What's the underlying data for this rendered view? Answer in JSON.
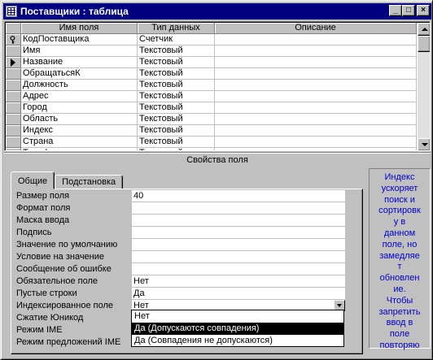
{
  "window": {
    "title": "Поставщики : таблица",
    "controls": [
      "_",
      "□",
      "×"
    ]
  },
  "grid": {
    "columns": [
      "Имя поля",
      "Тип данных",
      "Описание"
    ],
    "rows": [
      {
        "name": "КодПоставщика",
        "type": "Счетчик",
        "desc": "",
        "marker": "key"
      },
      {
        "name": "Имя",
        "type": "Текстовый",
        "desc": "",
        "marker": ""
      },
      {
        "name": "Название",
        "type": "Текстовый",
        "desc": "",
        "marker": "current"
      },
      {
        "name": "ОбращатьсяК",
        "type": "Текстовый",
        "desc": "",
        "marker": ""
      },
      {
        "name": "Должность",
        "type": "Текстовый",
        "desc": "",
        "marker": ""
      },
      {
        "name": "Адрес",
        "type": "Текстовый",
        "desc": "",
        "marker": ""
      },
      {
        "name": "Город",
        "type": "Текстовый",
        "desc": "",
        "marker": ""
      },
      {
        "name": "Область",
        "type": "Текстовый",
        "desc": "",
        "marker": ""
      },
      {
        "name": "Индекс",
        "type": "Текстовый",
        "desc": "",
        "marker": ""
      },
      {
        "name": "Страна",
        "type": "Текстовый",
        "desc": "",
        "marker": ""
      },
      {
        "name": "Телефон",
        "type": "Текстовый",
        "desc": "",
        "marker": ""
      }
    ]
  },
  "properties": {
    "header": "Свойства поля",
    "tabs": [
      {
        "label": "Общие",
        "active": true
      },
      {
        "label": "Подстановка",
        "active": false
      }
    ],
    "fields": [
      {
        "label": "Размер поля",
        "value": "40"
      },
      {
        "label": "Формат поля",
        "value": ""
      },
      {
        "label": "Маска ввода",
        "value": ""
      },
      {
        "label": "Подпись",
        "value": ""
      },
      {
        "label": "Значение по умолчанию",
        "value": ""
      },
      {
        "label": "Условие на значение",
        "value": ""
      },
      {
        "label": "Сообщение об ошибке",
        "value": ""
      },
      {
        "label": "Обязательное поле",
        "value": "Нет"
      },
      {
        "label": "Пустые строки",
        "value": "Да"
      },
      {
        "label": "Индексированное поле",
        "value": "Нет"
      },
      {
        "label": "Сжатие Юникод",
        "value": ""
      },
      {
        "label": "Режим IME",
        "value": ""
      },
      {
        "label": "Режим предложений IME",
        "value": ""
      }
    ],
    "dropdown_options": [
      {
        "label": "Нет",
        "selected": false
      },
      {
        "label": "Да (Допускаются совпадения)",
        "selected": true
      },
      {
        "label": "Да (Совпадения не допускаются)",
        "selected": false
      }
    ]
  },
  "help": {
    "lines": [
      "Индекс",
      "ускоряет",
      "поиск и",
      "сортировк",
      "у в",
      "данном",
      "поле, но",
      "замедляе",
      "т",
      "обновлен",
      "ие.",
      "Чтобы",
      "запретить",
      "ввод в",
      "поле",
      "повторяю"
    ]
  },
  "colors": {
    "titlebar": "#000080",
    "help_text": "#0000cc",
    "face": "#c0c0c0"
  }
}
